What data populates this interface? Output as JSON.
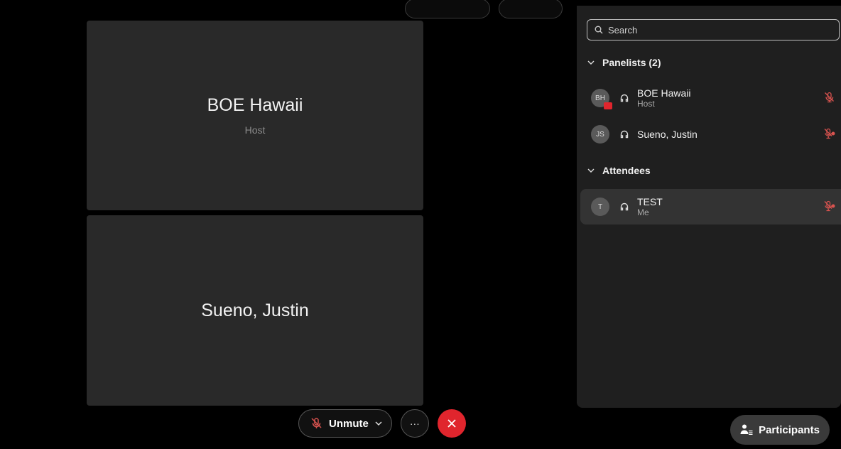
{
  "tiles": [
    {
      "name": "BOE Hawaii",
      "role": "Host"
    },
    {
      "name": "Sueno, Justin",
      "role": ""
    }
  ],
  "controls": {
    "unmute_label": "Unmute",
    "more_label": "···"
  },
  "panel": {
    "search_placeholder": "Search",
    "panelists_header": "Panelists (2)",
    "attendees_header": "Attendees",
    "panelists": [
      {
        "initials": "BH",
        "name": "BOE Hawaii",
        "role": "Host"
      },
      {
        "initials": "JS",
        "name": "Sueno, Justin",
        "role": ""
      }
    ],
    "attendees": [
      {
        "initials": "T",
        "name": "TEST",
        "role": "Me"
      }
    ]
  },
  "participants_button_label": "Participants",
  "colors": {
    "leave_red": "#e0252d",
    "mute_red": "#d9534f",
    "tile_bg": "#292929",
    "panel_bg": "#1f1f1f"
  },
  "icons": {
    "search": "search-icon",
    "chevron": "chevron-down-icon",
    "phone": "headset-icon",
    "muted": "mic-muted-icon",
    "leave": "close-icon",
    "participants": "participants-icon"
  }
}
